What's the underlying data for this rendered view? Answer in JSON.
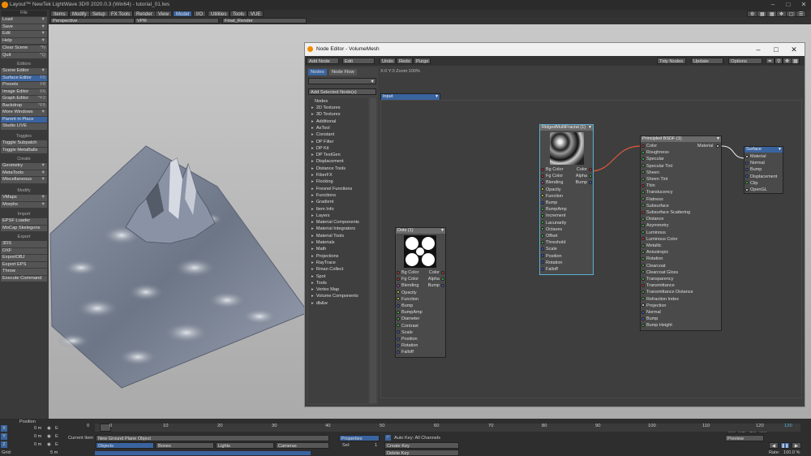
{
  "window": {
    "title": "Layout™ NewTek LightWave 3D® 2020.0.3 (Win64) - tutorial_01.lws"
  },
  "menu_tabs": [
    "Items",
    "Modify",
    "Setup",
    "FX Tools",
    "Render",
    "View",
    "Model",
    "I/O",
    "Utilities",
    "Tools",
    "VUE"
  ],
  "sidebar": {
    "file_header": "File",
    "file_items": [
      {
        "label": "Load"
      },
      {
        "label": "Save"
      },
      {
        "label": "Edit"
      },
      {
        "label": "Help"
      }
    ],
    "clear_scene": {
      "label": "Clear Scene",
      "shortcut": "^N"
    },
    "quit": {
      "label": "Quit",
      "shortcut": "^Q"
    },
    "editors_header": "Editors",
    "editors": [
      {
        "label": "Scene Editor",
        "shortcut": ""
      },
      {
        "label": "Surface Editor",
        "shortcut": "F5"
      },
      {
        "label": "Presets",
        "shortcut": "F8"
      },
      {
        "label": "Image Editor",
        "shortcut": "F6"
      },
      {
        "label": "Graph Editor",
        "shortcut": "^F2"
      },
      {
        "label": "Backdrop",
        "shortcut": "^F5"
      },
      {
        "label": "More Windows",
        "shortcut": ""
      },
      {
        "label": "Parent in Place",
        "shortcut": ""
      },
      {
        "label": "Studio LIVE",
        "shortcut": ""
      }
    ],
    "toggles_header": "Toggles",
    "toggles": [
      {
        "label": "Toggle Subpatch"
      },
      {
        "label": "Toggle MetaBalls"
      }
    ],
    "create_header": "Create",
    "create": [
      {
        "label": "Geometry"
      },
      {
        "label": "MetaTools"
      },
      {
        "label": "Miscellaneous"
      }
    ],
    "modify_header": "Modify",
    "modify": [
      {
        "label": "VMaps"
      },
      {
        "label": "Morphs"
      }
    ],
    "import_header": "Import",
    "import": [
      {
        "label": "EPSF Loader"
      },
      {
        "label": "MoCap Skelegons"
      }
    ],
    "export_header": "Export",
    "export": [
      {
        "label": "3DS"
      },
      {
        "label": "DXF"
      },
      {
        "label": "ExportOBJ"
      },
      {
        "label": "Export EPS"
      },
      {
        "label": "Throw"
      },
      {
        "label": "Execute Command"
      }
    ]
  },
  "viewport": {
    "view": "Perspective",
    "vpr": "VPR",
    "render": "Final_Render"
  },
  "node_editor": {
    "title": "Node Editor - VolumeMesh",
    "toolbar": [
      "Add Node",
      "Edit",
      "Undo",
      "Redo",
      "Purge",
      "Tidy Nodes",
      "Update",
      "Options"
    ],
    "tabs": [
      "Nodes",
      "Node Flow"
    ],
    "add_selected": "Add Selected Node(s)",
    "list_header": "Nodes",
    "categories": [
      "2D Textures",
      "3D Textures",
      "Additional",
      "AsTool",
      "Constant",
      "DP Filter",
      "DP Kit",
      "DP TextGen",
      "Displacement",
      "Distance Tools",
      "FiberFX",
      "Flocking",
      "Fresnel Functions",
      "Functions",
      "Gradient",
      "Item Info",
      "Layers",
      "Material Components",
      "Material Integrators",
      "Material Tools",
      "Materials",
      "Math",
      "Projections",
      "RayTrace",
      "Rman Collect",
      "Spot",
      "Tools",
      "Vertex Map",
      "Volume Components",
      "db&w"
    ],
    "zoom_info": "X:0 Y:0 Zoom:100%",
    "input_node": "Input",
    "ridged": {
      "title": "RidgedMultiFractal (1)",
      "inputs": [
        {
          "label": "Bg Color",
          "color": "#d33"
        },
        {
          "label": "Fg Color",
          "color": "#d33"
        },
        {
          "label": "Blending",
          "color": "#b5b"
        },
        {
          "label": "Opacity",
          "color": "#dd4"
        },
        {
          "label": "Function",
          "color": "#dd4"
        },
        {
          "label": "Bump",
          "color": "#46d"
        },
        {
          "label": "BumpAmp",
          "color": "#4c4"
        },
        {
          "label": "Increment",
          "color": "#4c4"
        },
        {
          "label": "Lacunarity",
          "color": "#4c4"
        },
        {
          "label": "Octaves",
          "color": "#4c4"
        },
        {
          "label": "Offset",
          "color": "#4c4"
        },
        {
          "label": "Threshold",
          "color": "#4c4"
        },
        {
          "label": "Scale",
          "color": "#46d"
        },
        {
          "label": "Position",
          "color": "#46d"
        },
        {
          "label": "Rotation",
          "color": "#46d"
        },
        {
          "label": "Falloff",
          "color": "#46d"
        }
      ],
      "outputs": [
        {
          "label": "Color",
          "color": "#d33"
        },
        {
          "label": "Alpha",
          "color": "#4c4"
        },
        {
          "label": "Bump",
          "color": "#46d"
        }
      ]
    },
    "dots": {
      "title": "Dots (1)",
      "inputs": [
        {
          "label": "Bg Color",
          "color": "#d33"
        },
        {
          "label": "Fg Color",
          "color": "#d33"
        },
        {
          "label": "Blending",
          "color": "#b5b"
        },
        {
          "label": "Opacity",
          "color": "#dd4"
        },
        {
          "label": "Function",
          "color": "#dd4"
        },
        {
          "label": "Bump",
          "color": "#46d"
        },
        {
          "label": "BumpAmp",
          "color": "#4c4"
        },
        {
          "label": "Diameter",
          "color": "#4c4"
        },
        {
          "label": "Contrast",
          "color": "#4c4"
        },
        {
          "label": "Scale",
          "color": "#46d"
        },
        {
          "label": "Position",
          "color": "#46d"
        },
        {
          "label": "Rotation",
          "color": "#46d"
        },
        {
          "label": "Falloff",
          "color": "#46d"
        }
      ],
      "outputs": [
        {
          "label": "Color",
          "color": "#d33"
        },
        {
          "label": "Alpha",
          "color": "#4c4"
        },
        {
          "label": "Bump",
          "color": "#46d"
        }
      ]
    },
    "bsdf": {
      "title": "Principled BSDF (1)",
      "output": "Material",
      "inputs": [
        {
          "label": "Color",
          "color": "#d33"
        },
        {
          "label": "Roughness",
          "color": "#4c4"
        },
        {
          "label": "Specular",
          "color": "#4c4"
        },
        {
          "label": "Specular Tint",
          "color": "#4c4"
        },
        {
          "label": "Sheen",
          "color": "#4c4"
        },
        {
          "label": "Sheen Tint",
          "color": "#4c4"
        },
        {
          "label": "Thin",
          "color": "#d33"
        },
        {
          "label": "Translucency",
          "color": "#4c4"
        },
        {
          "label": "Flatness",
          "color": "#4c4"
        },
        {
          "label": "Subsurface",
          "color": "#4c4"
        },
        {
          "label": "Subsurface Scattering",
          "color": "#d33"
        },
        {
          "label": "Distance",
          "color": "#4c4"
        },
        {
          "label": "Asymmetry",
          "color": "#4c4"
        },
        {
          "label": "Luminous",
          "color": "#4c4"
        },
        {
          "label": "Luminous Color",
          "color": "#d33"
        },
        {
          "label": "Metallic",
          "color": "#4c4"
        },
        {
          "label": "Anisotropic",
          "color": "#4c4"
        },
        {
          "label": "Rotation",
          "color": "#4c4"
        },
        {
          "label": "Clearcoat",
          "color": "#4c4"
        },
        {
          "label": "Clearcoat Gloss",
          "color": "#4c4"
        },
        {
          "label": "Transparency",
          "color": "#4c4"
        },
        {
          "label": "Transmittance",
          "color": "#d33"
        },
        {
          "label": "Transmittance Distance",
          "color": "#4c4"
        },
        {
          "label": "Refraction Index",
          "color": "#4c4"
        },
        {
          "label": "Projection",
          "color": "#eee"
        },
        {
          "label": "Normal",
          "color": "#46d"
        },
        {
          "label": "Bump",
          "color": "#46d"
        },
        {
          "label": "Bump Height",
          "color": "#4c4"
        }
      ]
    },
    "surface": {
      "title": "Surface",
      "inputs": [
        {
          "label": "Material",
          "color": "#eee"
        },
        {
          "label": "Normal",
          "color": "#46d"
        },
        {
          "label": "Bump",
          "color": "#46d"
        },
        {
          "label": "Displacement",
          "color": "#46d"
        },
        {
          "label": "Clip",
          "color": "#4c4"
        },
        {
          "label": "OpenGL",
          "color": "#eee"
        }
      ]
    }
  },
  "bottom": {
    "position_label": "Position",
    "axes": [
      {
        "axis": "X",
        "value": "0 m"
      },
      {
        "axis": "Y",
        "value": "0 m"
      },
      {
        "axis": "Z",
        "value": "0 m"
      }
    ],
    "grid_label": "Grid:",
    "grid_value": "5 m",
    "current_item_label": "Current Item",
    "current_item": "New Ground Plane Object",
    "item_types": [
      "Objects",
      "Bones",
      "Lights",
      "Cameras"
    ],
    "properties": "Properties",
    "sel_label": "Sel:",
    "sel_value": "1",
    "auto_key": "Auto Key: All Channels",
    "create_key": "Create Key",
    "delete_key": "Delete Key",
    "timeline_ticks": [
      "0",
      "10",
      "20",
      "30",
      "40",
      "50",
      "60",
      "70",
      "80",
      "90",
      "100",
      "110",
      "120"
    ],
    "frame_start": "0",
    "frame_end": "120",
    "preview": "Preview",
    "rate_label": "Rate:",
    "rate_value": "100.0 %"
  },
  "colors": {
    "accent": "#3a64a0",
    "selection_outline": "#5ab0d6",
    "connection": "#e05a3a"
  }
}
